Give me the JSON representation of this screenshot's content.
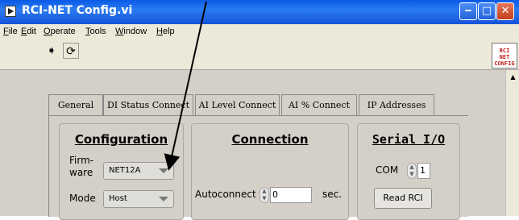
{
  "window": {
    "title": "RCI-NET Config.vi"
  },
  "title_buttons": {
    "minimize": "‒",
    "maximize": "□",
    "close": "✕"
  },
  "menu": {
    "items": [
      {
        "u": "F",
        "rest": "ile"
      },
      {
        "u": "E",
        "rest": "dit"
      },
      {
        "u": "O",
        "rest": "perate"
      },
      {
        "u": "T",
        "rest": "ools"
      },
      {
        "u": "W",
        "rest": "indow"
      },
      {
        "u": "H",
        "rest": "elp"
      }
    ]
  },
  "toolbar": {
    "run_icon": "➧",
    "run_continuous_icon": "⟳",
    "vi_icon_text": [
      "RCI",
      "NET",
      "CONFIG"
    ]
  },
  "tabs": [
    {
      "label": "General",
      "active": true
    },
    {
      "label": "DI Status Connect",
      "active": false
    },
    {
      "label": "AI Level Connect",
      "active": false
    },
    {
      "label": "AI % Connect",
      "active": false
    },
    {
      "label": "IP Addresses",
      "active": false
    }
  ],
  "configuration": {
    "title": "Configuration",
    "firmware_label_line1": "Firm-",
    "firmware_label_line2": "ware",
    "firmware_value": "NET12A",
    "mode_label": "Mode",
    "mode_value": "Host"
  },
  "connection": {
    "title": "Connection",
    "autoconnect_label": "Autoconnect",
    "autoconnect_value": "0",
    "unit": "sec."
  },
  "serial_io": {
    "title": "Serial I/O",
    "com_label": "COM",
    "com_value": "1",
    "read_button": "Read RCI"
  },
  "colors": {
    "titlebar": "#0a5ae6",
    "panel": "#d4d0c8",
    "vi_icon_text": "#c02020"
  }
}
